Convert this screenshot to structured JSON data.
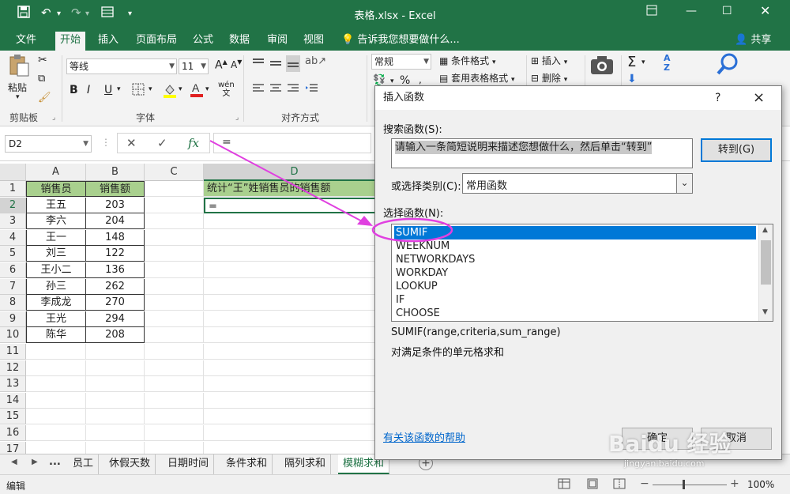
{
  "window": {
    "title": "表格.xlsx - Excel",
    "quick_access": [
      "save-icon",
      "undo-icon",
      "redo-icon",
      "form-icon",
      "customize-icon"
    ],
    "controls": [
      "ribbon-display-icon",
      "minimize-icon",
      "maximize-icon",
      "close-icon"
    ]
  },
  "ribbon_tabs": [
    "文件",
    "开始",
    "插入",
    "页面布局",
    "公式",
    "数据",
    "审阅",
    "视图"
  ],
  "active_tab": "开始",
  "tell_me": "告诉我您想要做什么...",
  "share": "共享",
  "ribbon": {
    "paste": "粘贴",
    "clipboard_label": "剪贴板",
    "font_name": "等线",
    "font_size": "11",
    "font_label": "字体",
    "bold": "B",
    "italic": "I",
    "underline": "U",
    "align_label": "对齐方式",
    "number_format": "常规",
    "cond_format": "条件格式",
    "table_format": "套用表格格式",
    "insert": "插入",
    "delete": "删除",
    "wen": "wén\n文",
    "percent": "%",
    "sigma": "Σ",
    "sort": "A\nZ"
  },
  "formula_bar": {
    "name_box": "D2",
    "formula": "="
  },
  "grid": {
    "columns": [
      "A",
      "B",
      "C",
      "D"
    ],
    "rows": [
      "1",
      "2",
      "3",
      "4",
      "5",
      "6",
      "7",
      "8",
      "9",
      "10",
      "11",
      "12",
      "13",
      "14",
      "15",
      "16",
      "17"
    ],
    "header": [
      "销售员",
      "销售额"
    ],
    "data": [
      [
        "王五",
        "203"
      ],
      [
        "李六",
        "204"
      ],
      [
        "王一",
        "148"
      ],
      [
        "刘三",
        "122"
      ],
      [
        "王小二",
        "136"
      ],
      [
        "孙三",
        "262"
      ],
      [
        "李成龙",
        "270"
      ],
      [
        "王光",
        "294"
      ],
      [
        "陈华",
        "208"
      ]
    ],
    "d1": "统计“王”姓销售员的销售额",
    "d2": "="
  },
  "sheets": {
    "tabs": [
      "员工",
      "休假天数",
      "日期时间",
      "条件求和",
      "隔列求和",
      "模糊求和"
    ],
    "active": "模糊求和",
    "ellipsis": "..."
  },
  "status": {
    "mode": "编辑",
    "zoom": "100%"
  },
  "dialog": {
    "title": "插入函数",
    "help_q": "?",
    "close": "×",
    "search_label": "搜索函数(S):",
    "search_value": "请输入一条简短说明来描述您想做什么，然后单击“转到”",
    "go_button": "转到(G)",
    "category_label": "或选择类别(C):",
    "category_value": "常用函数",
    "select_label": "选择函数(N):",
    "functions": [
      "SUMIF",
      "WEEKNUM",
      "NETWORKDAYS",
      "WORKDAY",
      "LOOKUP",
      "IF",
      "CHOOSE"
    ],
    "selected_function": "SUMIF",
    "signature": "SUMIF(range,criteria,sum_range)",
    "description": "对满足条件的单元格求和",
    "help_link": "有关该函数的帮助",
    "ok": "确定",
    "cancel": "取消"
  },
  "watermark": {
    "brand": "Baidu 经验",
    "url": "jingyan.baidu.com"
  },
  "colors": {
    "excel_green": "#217346",
    "header_fill": "#a9d08e",
    "selection_blue": "#0078d7",
    "annotation_magenta": "#e040e0"
  }
}
